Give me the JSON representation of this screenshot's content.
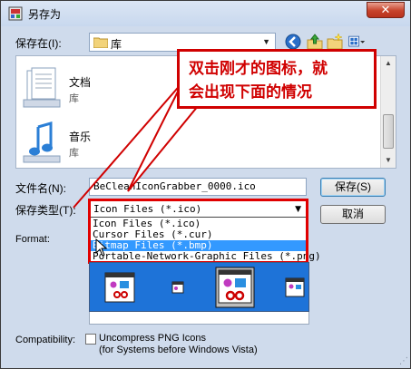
{
  "window": {
    "title": "另存为",
    "close_label": "✕"
  },
  "address": {
    "label": "保存在(I):",
    "value": "库"
  },
  "toolbar": {
    "back_icon": "back-arrow-icon",
    "up_icon": "up-folder-icon",
    "new_folder_icon": "new-folder-icon",
    "view_icon": "view-menu-icon"
  },
  "file_list": {
    "items": [
      {
        "name": "文档",
        "sub": "库",
        "icon": "documents-library-icon"
      },
      {
        "name": "音乐",
        "sub": "库",
        "icon": "music-library-icon"
      }
    ]
  },
  "filename": {
    "label": "文件名(N):",
    "value": "BeCleanIconGrabber_0000.ico"
  },
  "filetype": {
    "label": "保存类型(T):",
    "value": "Icon Files (*.ico)",
    "options": [
      "Icon Files (*.ico)",
      "Cursor Files (*.cur)",
      "Bitmap Files (*.bmp)",
      "Portable-Network-Graphic Files (*.png)"
    ],
    "selected_index": 2
  },
  "buttons": {
    "save": "保存(S)",
    "cancel": "取消"
  },
  "format": {
    "label": "Format:"
  },
  "compatibility": {
    "label": "Compatibility:",
    "checkbox_line1": "Uncompress PNG Icons",
    "checkbox_line2": "(for Systems before Windows Vista)",
    "checked": false
  },
  "callout": {
    "line1": "双击刚才的图标，就",
    "line2": "会出现下面的情况"
  },
  "colors": {
    "annotation_red": "#e00000",
    "selection_blue": "#3399ff",
    "preview_blue": "#1e73d8"
  }
}
